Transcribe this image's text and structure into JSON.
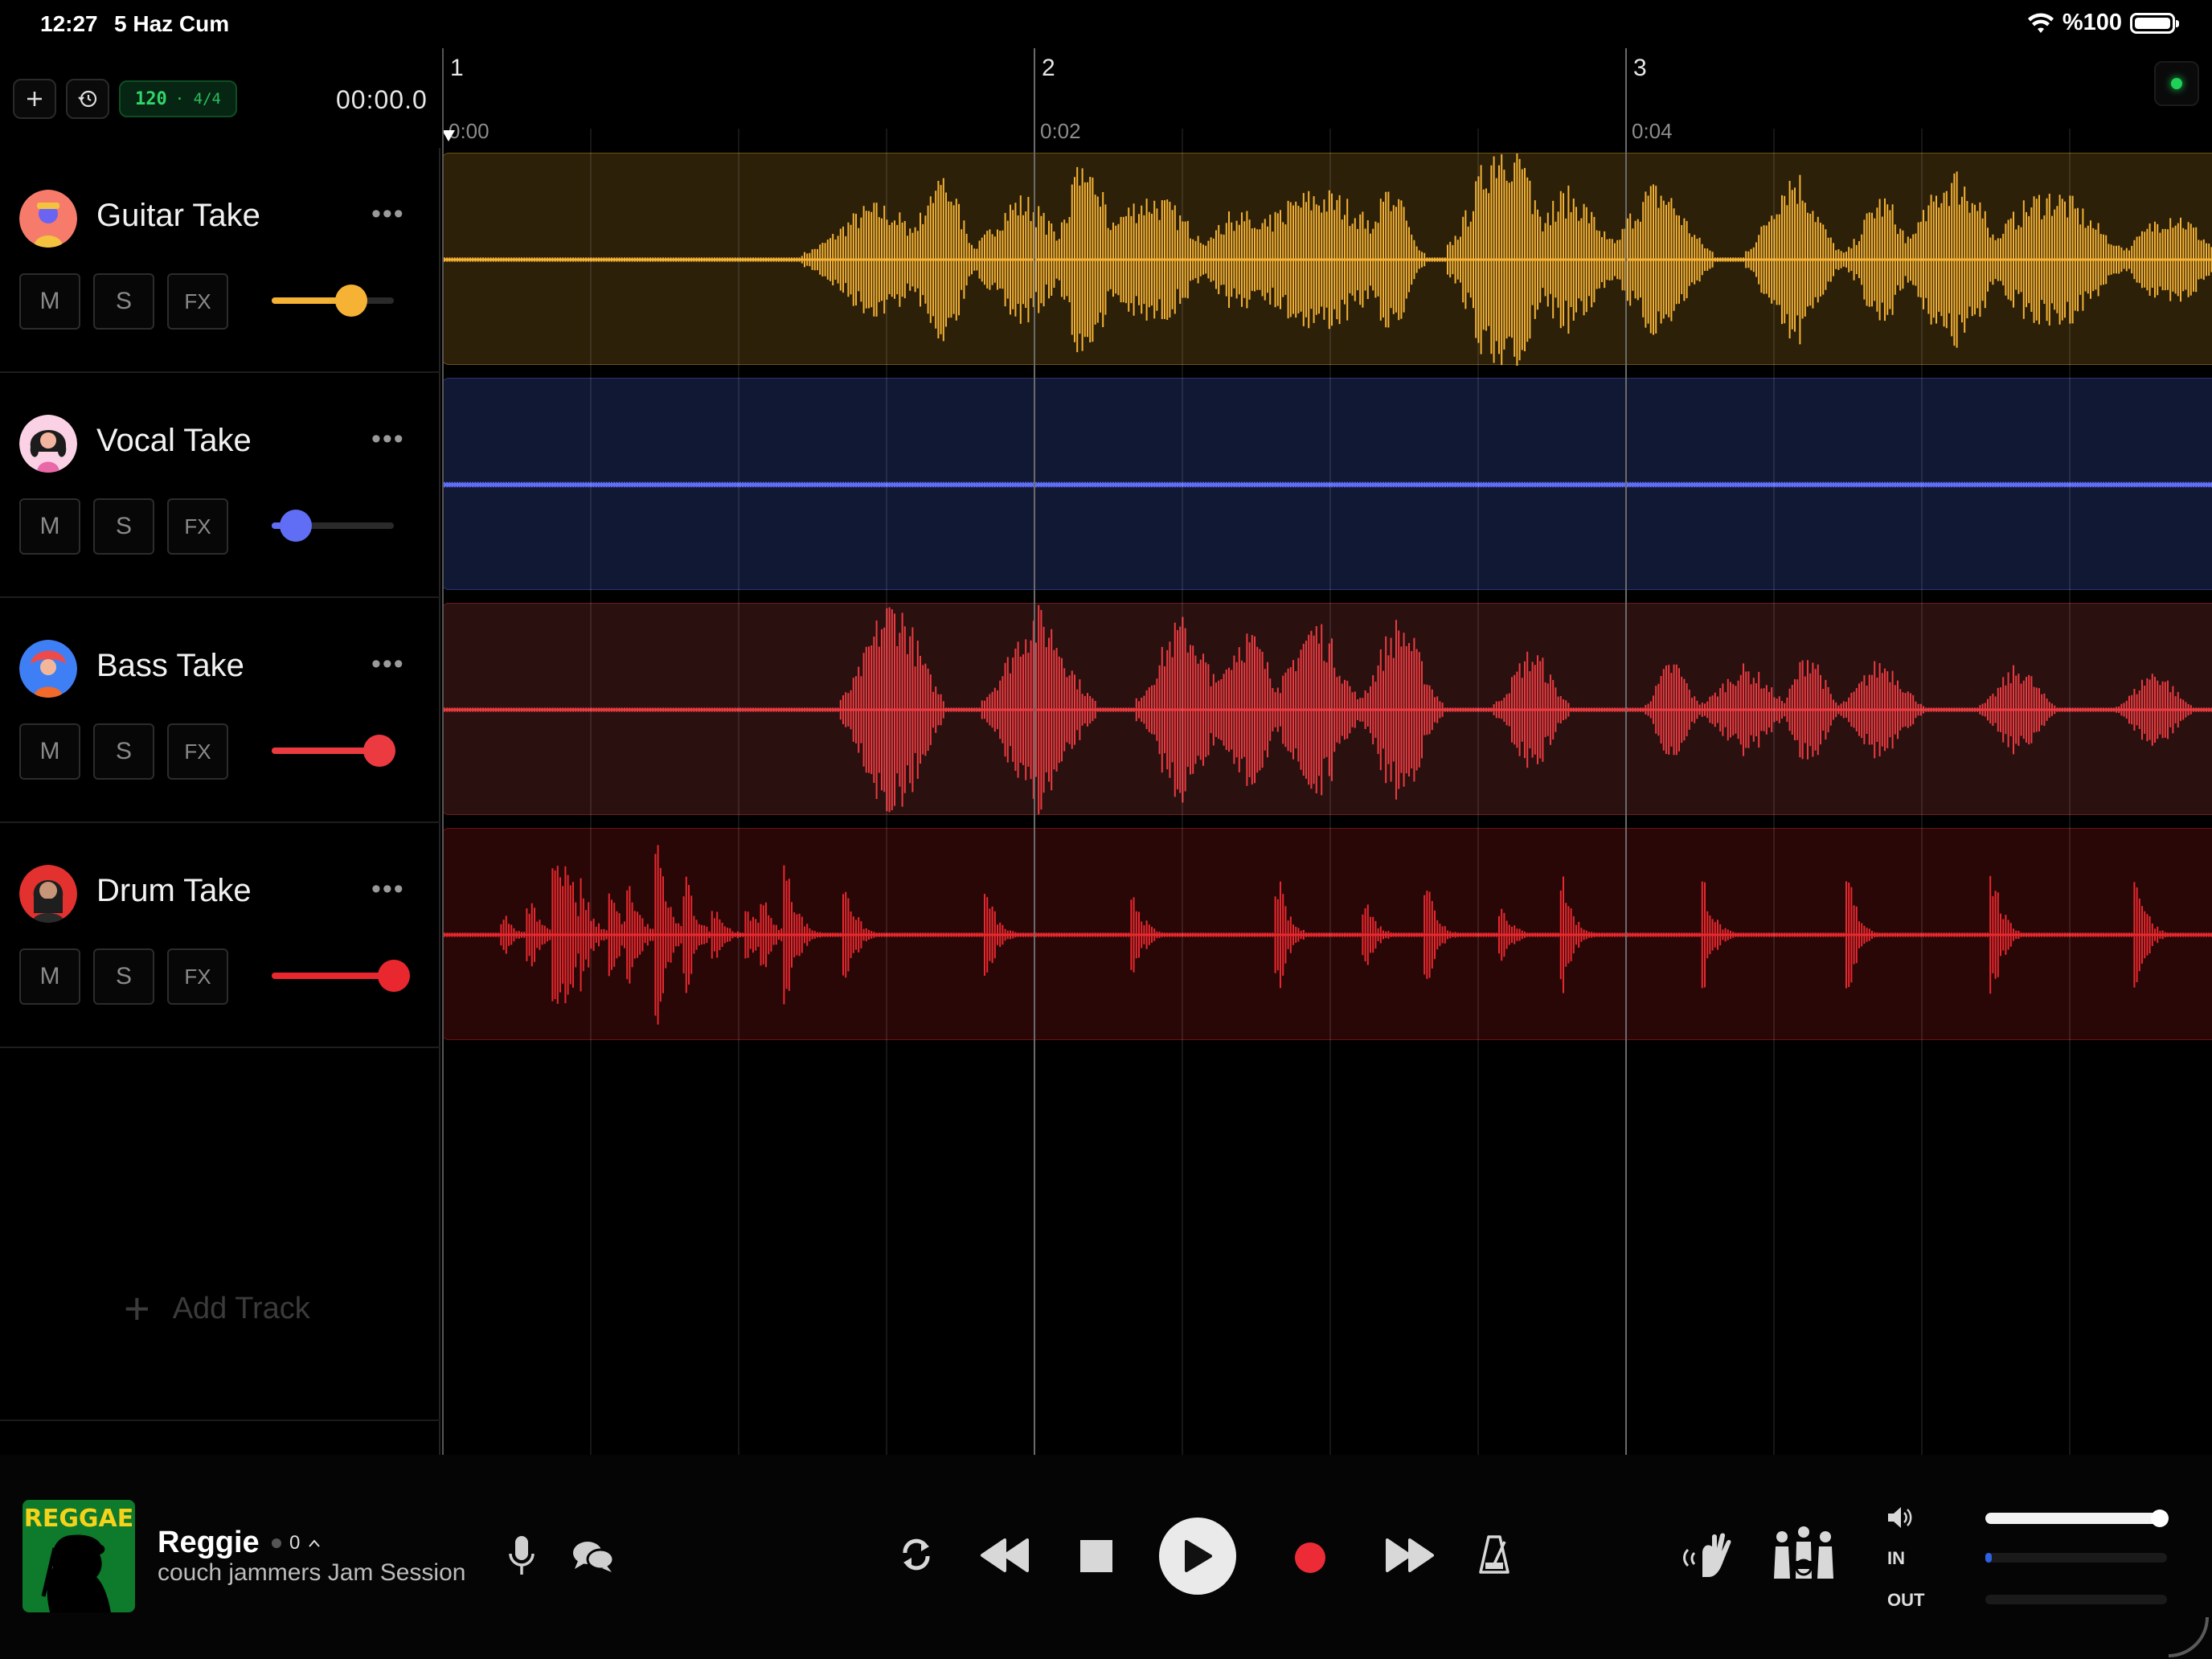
{
  "status_bar": {
    "time": "12:27",
    "date": "5 Haz Cum",
    "battery": "%100"
  },
  "toolbar": {
    "add_icon": "plus-icon",
    "history_icon": "history-icon",
    "tempo": "120",
    "signature": "· 4/4",
    "clock": "00:00.0"
  },
  "timeline": {
    "bars": [
      "1",
      "2",
      "3"
    ],
    "time_labels": [
      "0:00",
      "0:02",
      "0:04"
    ]
  },
  "tracks": [
    {
      "name": "Guitar Take",
      "mute": "M",
      "solo": "S",
      "fx": "FX",
      "color": "#f5b234",
      "clip_bg": "#2c2009",
      "volume": 0.65
    },
    {
      "name": "Vocal Take",
      "mute": "M",
      "solo": "S",
      "fx": "FX",
      "color": "#5f6ef4",
      "clip_bg": "#111833",
      "volume": 0.2
    },
    {
      "name": "Bass Take",
      "mute": "M",
      "solo": "S",
      "fx": "FX",
      "color": "#ec3b40",
      "clip_bg": "#2b1010",
      "volume": 0.88
    },
    {
      "name": "Drum Take",
      "mute": "M",
      "solo": "S",
      "fx": "FX",
      "color": "#e8282e",
      "clip_bg": "#2a0707",
      "volume": 1.0
    }
  ],
  "add_track_label": "Add Track",
  "session": {
    "cover_text": "REGGAE",
    "room_name": "Reggie",
    "listeners": "0",
    "subtitle": "couch jammers Jam Session"
  },
  "mixer": {
    "in_label": "IN",
    "out_label": "OUT",
    "master_volume": 0.96,
    "in_level": 0.03,
    "out_level": 0.0
  }
}
